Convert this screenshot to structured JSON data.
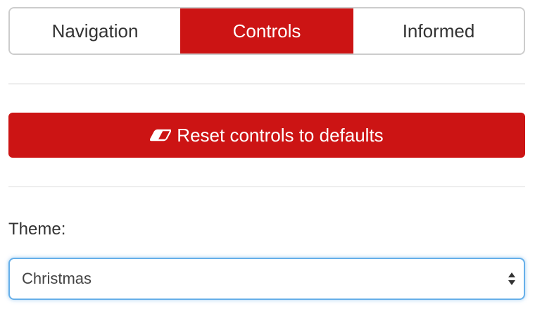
{
  "tabs": [
    {
      "label": "Navigation",
      "active": false
    },
    {
      "label": "Controls",
      "active": true
    },
    {
      "label": "Informed",
      "active": false
    }
  ],
  "reset_button": {
    "label": "Reset controls to defaults",
    "icon": "eraser-icon"
  },
  "theme": {
    "label": "Theme:",
    "selected": "Christmas"
  },
  "colors": {
    "accent": "#cc1414",
    "focus_border": "#66afe9",
    "border": "#cccccc"
  }
}
